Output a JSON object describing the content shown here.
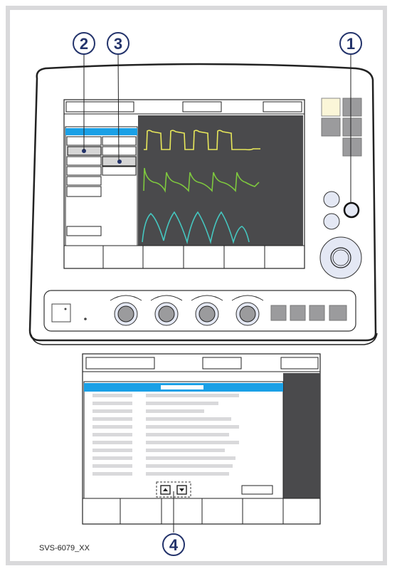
{
  "callouts": [
    {
      "number": "1",
      "target": "knob-button"
    },
    {
      "number": "2",
      "target": "settings-field"
    },
    {
      "number": "3",
      "target": "settings-field"
    },
    {
      "number": "4",
      "target": "scroll-arrows"
    }
  ],
  "figure_id": "SVS-6079_XX",
  "colors": {
    "accent_blue": "#1aa0e6",
    "callout_blue": "#23336b",
    "waveform_pressure": "#e8e85a",
    "waveform_flow": "#7ec83e",
    "waveform_volume": "#45c7c0",
    "screen_dark": "#4a4a4c",
    "panel_gray": "#d9d9db"
  },
  "icons": [
    "scroll-up-arrow-icon",
    "scroll-down-arrow-icon",
    "rotary-knob-icon"
  ]
}
